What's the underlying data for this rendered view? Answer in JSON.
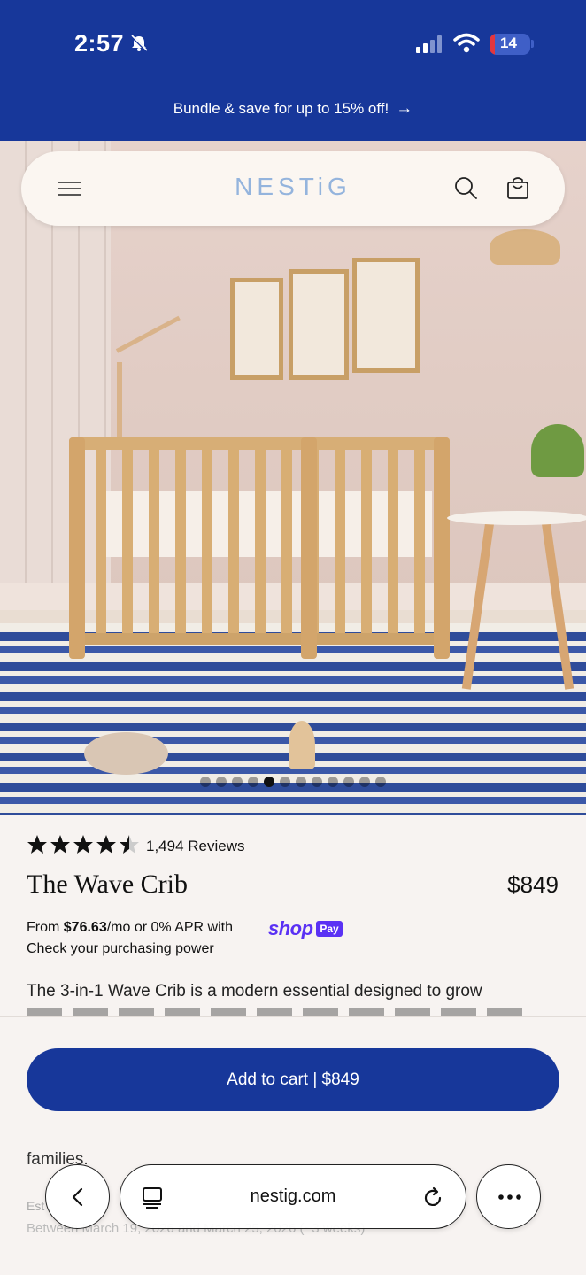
{
  "status_bar": {
    "time": "2:57",
    "battery_level": "14"
  },
  "announcement": {
    "text": "Bundle & save for up to 15% off!",
    "arrow": "→"
  },
  "header": {
    "logo": "NESTiG",
    "icons": [
      "menu-icon",
      "search-icon",
      "shopping-bag-icon"
    ]
  },
  "gallery": {
    "total_images": 12,
    "active_index": 4
  },
  "product": {
    "rating": 4.5,
    "reviews_label": "1,494 Reviews",
    "title": "The Wave Crib",
    "price": "$849",
    "financing_prefix": "From ",
    "financing_amount": "$76.63",
    "financing_suffix": "/mo or 0% APR with",
    "shop_pay_word": "shop",
    "shop_pay_badge": "Pay",
    "check_power": "Check your purchasing power",
    "description": "The 3-in-1 Wave Crib is a modern essential designed to grow"
  },
  "cart": {
    "add_to_cart_label": "Add to cart | $849"
  },
  "below": {
    "families_text": "families.",
    "estimate_prefix": "Est",
    "between_text": "Between March 19, 2026 and March 25, 2026 (~3 weeks)"
  },
  "browser": {
    "url": "nestig.com"
  },
  "colors": {
    "brand_blue": "#17379a",
    "logo_blue": "#94b4dd",
    "shop_pay_purple": "#5a31f4",
    "background": "#f7f3f1"
  }
}
